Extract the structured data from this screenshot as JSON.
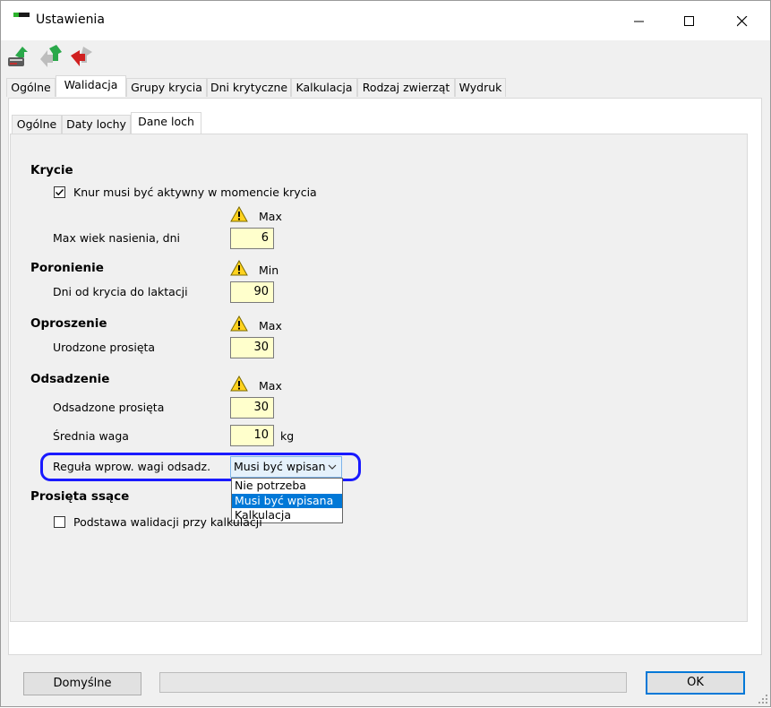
{
  "window": {
    "title": "Ustawienia",
    "minimize": "—",
    "maximize": "☐",
    "close": "✕"
  },
  "toolbar": {
    "icons": [
      "database-sync-icon",
      "green-arrows-icon",
      "red-arrows-icon"
    ]
  },
  "main_tabs": [
    "Ogólne",
    "Walidacja",
    "Grupy krycia",
    "Dni krytyczne",
    "Kalkulacja",
    "Rodzaj zwierząt",
    "Wydruk"
  ],
  "main_tab_active": "Walidacja",
  "sub_tabs": [
    "Ogólne",
    "Daty lochy",
    "Dane loch"
  ],
  "sub_tab_active": "Dane loch",
  "sections": {
    "krycie": {
      "title": "Krycie",
      "checkbox_label": "Knur musi być aktywny w momencie krycia",
      "checkbox_checked": true,
      "limit_label": "Max",
      "field_label": "Max wiek nasienia, dni",
      "field_value": "6"
    },
    "poronienie": {
      "title": "Poronienie",
      "limit_label": "Min",
      "field_label": "Dni od krycia do laktacji",
      "field_value": "90"
    },
    "oproszenie": {
      "title": "Oproszenie",
      "limit_label": "Max",
      "field_label": "Urodzone prosięta",
      "field_value": "30"
    },
    "odsadzenie": {
      "title": "Odsadzenie",
      "limit_label": "Max",
      "field1_label": "Odsadzone prosięta",
      "field1_value": "30",
      "field2_label": "Średnia waga",
      "field2_value": "10",
      "field2_unit": "kg",
      "rule_label": "Reguła wprow. wagi odsadz.",
      "rule_value": "Musi być wpisan",
      "rule_options": [
        "Nie potrzeba",
        "Musi być wpisana",
        "Kalkulacja"
      ],
      "rule_selected_index": 1
    },
    "prosieta": {
      "title": "Prosięta ssące",
      "checkbox_label": "Podstawa walidacji przy kalkulacji",
      "checkbox_checked": false
    }
  },
  "footer": {
    "default_button": "Domyślne",
    "ok_button": "OK"
  },
  "colors": {
    "highlight_border": "#1a1aff",
    "field_background": "#ffffcc",
    "selected_option": "#0078d7"
  }
}
